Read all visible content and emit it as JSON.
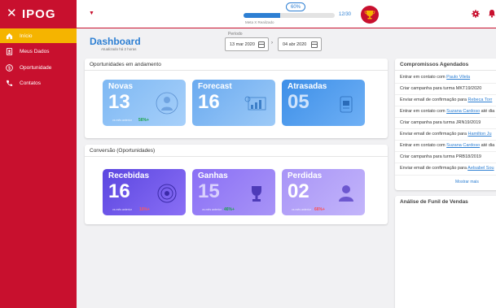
{
  "sidebar": {
    "close_icon": "close-icon",
    "logo": "IPOG",
    "items": [
      {
        "label": "Início",
        "icon": "home-icon",
        "active": true
      },
      {
        "label": "Meus Dados",
        "icon": "id-card-icon",
        "active": false
      },
      {
        "label": "Oportunidade",
        "icon": "dollar-icon",
        "active": false
      },
      {
        "label": "Contatos",
        "icon": "phone-icon",
        "active": false
      }
    ]
  },
  "header": {
    "meta_badge": "60%",
    "progress_fraction": 0.4,
    "progress_count": "12/30",
    "progress_sub": "Meta X Realizado"
  },
  "dashboard": {
    "title": "Dashboard",
    "subtitle": "Atualizado há 2 horas",
    "period_label": "Período",
    "date_from": "13 mar 2020",
    "date_to": "04 abr 2020"
  },
  "oportunidades": {
    "title": "Oportunidades em andamento",
    "cards": [
      {
        "label": "Novas",
        "value": "13",
        "foot": "vs mês anterior",
        "pct": "56%+"
      },
      {
        "label": "Forecast",
        "value": "16"
      },
      {
        "label": "Atrasadas",
        "value": "05"
      }
    ]
  },
  "conversao": {
    "title": "Conversão (Oportunidades)",
    "cards": [
      {
        "label": "Recebidas",
        "value": "16",
        "foot": "vs mês anterior",
        "pct": "16%+"
      },
      {
        "label": "Ganhas",
        "value": "15",
        "foot": "vs mês anterior",
        "pct": "46%+"
      },
      {
        "label": "Perdidas",
        "value": "02",
        "foot": "vs mês anterior",
        "pct": "66%+"
      }
    ]
  },
  "compromissos": {
    "title": "Compromissos Agendados",
    "items": [
      {
        "text": "Entrar em contato com ",
        "link": "Paulo Vilela"
      },
      {
        "text": "Criar campanha para turma MKT19/2020",
        "link": ""
      },
      {
        "text": "Enviar email de confirmação para ",
        "link": "Rebeca Torr"
      },
      {
        "text": "Entrar em contato com ",
        "link": "Suzana Cardoso",
        "tail": " até dia"
      },
      {
        "text": "Criar campanha para turma JRN19/2019",
        "link": ""
      },
      {
        "text": "Enviar email de confirmação para ",
        "link": "Hamilton Ju"
      },
      {
        "text": "Entrar em contato com ",
        "link": "Suzana Cardoso",
        "tail": " até dia"
      },
      {
        "text": "Criar campanha para turma PRB18/2019",
        "link": ""
      },
      {
        "text": "Enviar email de confirmação para ",
        "link": "Aelsabel Sou"
      }
    ],
    "more": "Mostrar mais"
  },
  "funil": {
    "title": "Análise de Funil de Vendas"
  },
  "colors": {
    "brand_red": "#c8102e",
    "active_yellow": "#f5b400",
    "accent_blue": "#2d7fd3"
  }
}
